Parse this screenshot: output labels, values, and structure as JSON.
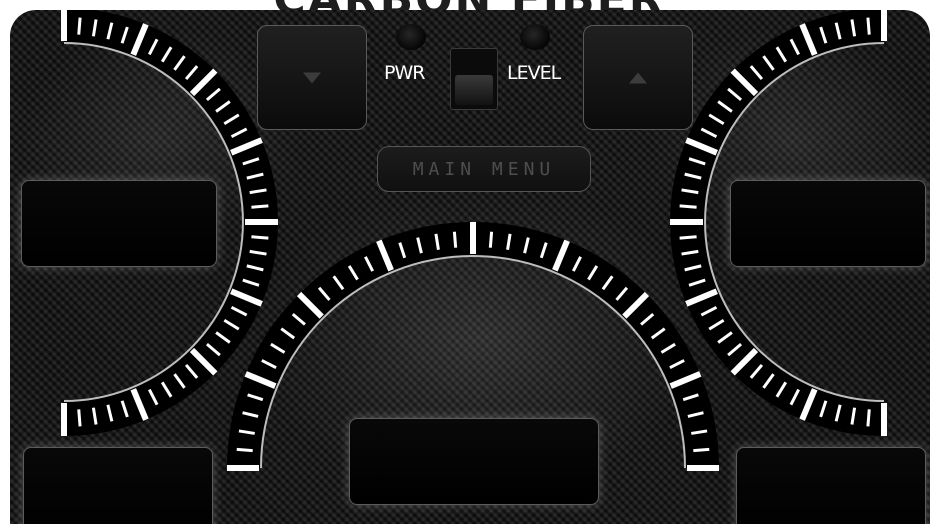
{
  "header": {
    "title": "CARBON FIBER"
  },
  "controls": {
    "pwr_label": "PWR",
    "level_label": "LEVEL",
    "main_menu_label": "MAIN MENU",
    "down_icon": "triangle-down-icon",
    "up_icon": "triangle-up-icon"
  },
  "colors": {
    "background": "#151515",
    "tick": "#ffffff",
    "label": "#ffffff",
    "menu_text": "#4e4e4e"
  },
  "displays": {
    "left": "",
    "right": "",
    "center": "",
    "bottom_left": "",
    "bottom_right": ""
  }
}
